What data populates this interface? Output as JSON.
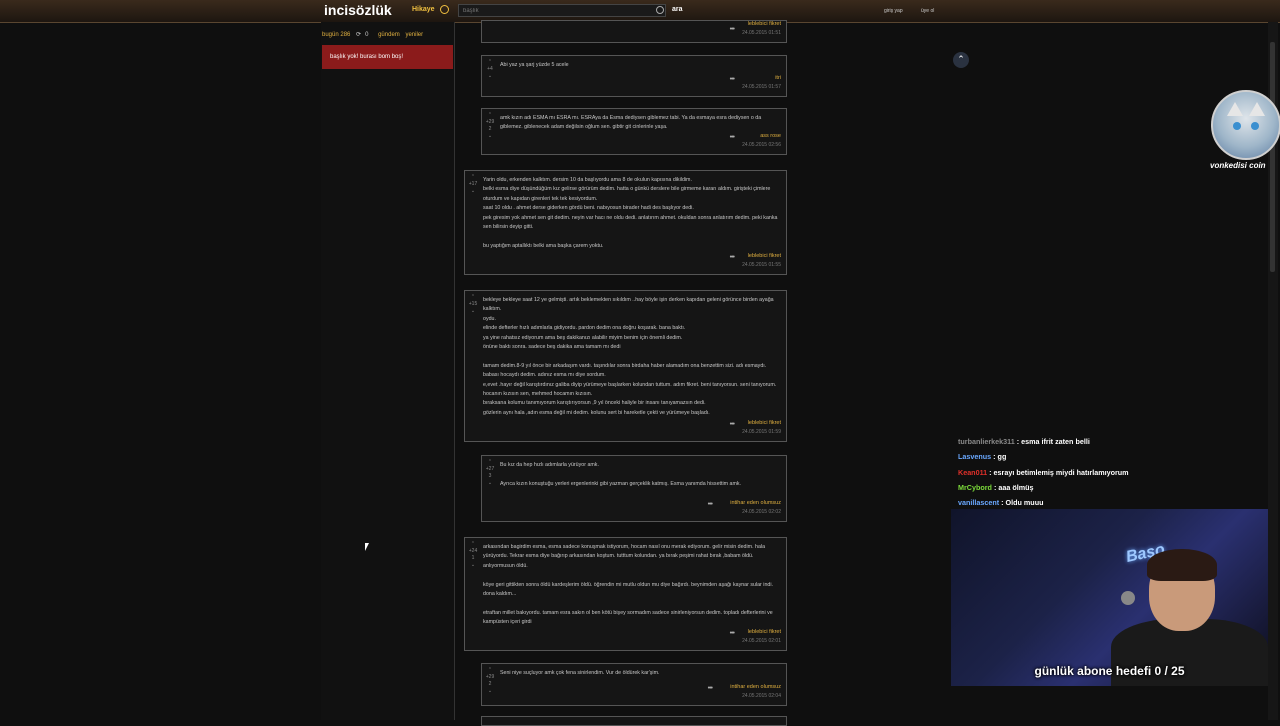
{
  "header": {
    "logo": "incisözlük",
    "story_label": "Hikaye",
    "search_placeholder": "başlık",
    "search_button": "ara",
    "login": "giriş yap",
    "signup": "üye ol"
  },
  "left_nav": {
    "today": "bugün 286",
    "refresh_count": "0",
    "agenda": "gündem",
    "new": "yeniler",
    "empty_message": "başlık yok! burası bom boş!"
  },
  "entries": [
    {
      "votes_up": "",
      "votes_down": "",
      "text": "",
      "author": "leblebici fikret",
      "date": "24.05.2015 01:51"
    },
    {
      "votes_up": "+4",
      "votes_down": "",
      "text": "Abi yaz ya şarj yüzde 5 acele",
      "author": "itri",
      "date": "24.05.2015 01:57"
    },
    {
      "votes_up": "+29",
      "votes_down": "2",
      "text": "amk kızın adı ESMA mı ESRA mı. ESRAya da Esma dediysen giblemez tabi. Ya da esmaya esra dediysen o da giblemez. giblenecek adam değilsin oğlum sen. gibtir git cinlerinle yaşa.",
      "author": "ass rose",
      "date": "24.05.2015 02:56"
    },
    {
      "votes_up": "+17",
      "votes_down": "",
      "text": "Yarin oldu, erkenden kalktım. dersim 10 da başlıyordu ama 8 de okulun kapısına dikildim.\nbelki esma diye düşündüğüm kız gelirse görürüm dedim. hatta o günkü derslere bile girmeme kararı aldım. girişteki çimlere oturdum ve kapıdan girenleri tek tek kesiyordum.\nsaat 10 oldu . ahmet derse giderken gördü beni. nabıyosun birader hadi des başlıyor dedi.\npek giresim yok ahmet sen git dedim. neyin var hacı ne oldu dedi. anlatırım ahmet. okuldan sonra anlatırım dedim. peki kanka sen bilirsin deyip gitti.\n\nbu yaptığım aptallıktı belki ama başka çarem yoktu.",
      "author": "leblebici fikret",
      "date": "24.05.2015 01:55"
    },
    {
      "votes_up": "+15",
      "votes_down": "",
      "text": "bekleye bekleye saat 12 ye gelmişti. artık beklemekten sıkıldım ..hay böyle işin derken kapıdan geleni görünce birden ayağa kalktım.\noydu.\nelinde defterler hızlı adımlarla gidiyordu. pardon dedim ona doğru koşarak. bana baktı.\nya yine rahatsız ediyorum ama beş dakikanızı alabilir miyim benim için önemli dedim.\nönüne baktı sonra. sadece beş dakika ama tamam mı dedi\n\ntamam dedim.8-9 yıl önce bir arkadaşım vardı. taşındılar sonra birdaha haber alamadım ona benzettim sizi. adı esmaydı. babası hocaydı dedim. adınız esma mı diye sordum.\ne,evet .hayır değil karıştırdınız galiba diyip yürümeye başlarken kolundan tuttum. adım fikret. beni tanıyorsun. seni tanıyorum. hocanın kızısın sen, mehmed hocamın kızısın.\nbıraksana kolumu tanımıyorum karıştırıyorsun ,9 yıl önceki haliyle bir insanı tanıyamazsın dedi.\ngözlerin aynı hala ,adın esma değil mi dedim. kolunu sert bi hareketle çekti ve yürümeye başladı.",
      "author": "leblebici fikret",
      "date": "24.05.2015 01:59"
    },
    {
      "votes_up": "+27",
      "votes_down": "3",
      "text": "Bu kız da hep hızlı adımlarla yürüyor amk.\n\nAyrıca kızın konuştuğu yerleri ergenlerinki gibi yazman gerçeklik katmış. Esma yanımda hissettim amk.",
      "author": "intihar eden olumsuz",
      "date": "24.05.2015 02:02"
    },
    {
      "votes_up": "+24",
      "votes_down": "1",
      "text": "arkasından bagirdim esma, esma sadece konuşmak istiyorum, hocam nasıl onu merak ediyorum. gelir misin dedim. hala yürüyordu. Tekrar esma diye bağırıp arkasından koştum. tutttum kolundan. ya bırak peşimi rahat bırak ,babam öldü. anlıyormusun öldü.\n\nköye geri gittikten sonra öldü kardeşlerim öldü. öğrendin mi mutlu oldun mu diye bağırdı. beynimden aşağı kaynar sular indi. dona kaldım...\n\netraftan millet bakıyordu. tamam esra sakın ol ben kötü bişey sormadım sadece sinirleniyorsun dedim. topladı defterlerini ve kampüsten içeri girdi",
      "author": "leblebici fikret",
      "date": "24.05.2015 02:01"
    },
    {
      "votes_up": "+29",
      "votes_down": "2",
      "text": "Seni niye suçluyor amk çok fena sinirlendim. Vur de öldürek kar'şim.",
      "author": "intihar eden olumsuz",
      "date": "24.05.2015 02:04"
    }
  ],
  "stream": {
    "cat_label": "vonkedisi coin",
    "chat": [
      {
        "user": "turbanlierkek311",
        "message": " : esma ifrit zaten belli",
        "color": "#8a8a8a"
      },
      {
        "user": "Lasvenus",
        "message": " : gg",
        "color": "#6aa8ff"
      },
      {
        "user": "Kean011",
        "message": " : esrayı betimlemiş miydi hatırlamıyorum",
        "color": "#e0302a"
      },
      {
        "user": "MrCybord",
        "message": " : aaa ölmüş",
        "color": "#7cdc3a"
      },
      {
        "user": "vanillascent",
        "message": " : Oldu muuu",
        "color": "#6aa8ff"
      }
    ],
    "webcam_neon": "Başo",
    "goal_text": "günlük abone hedefi 0 / 25"
  }
}
